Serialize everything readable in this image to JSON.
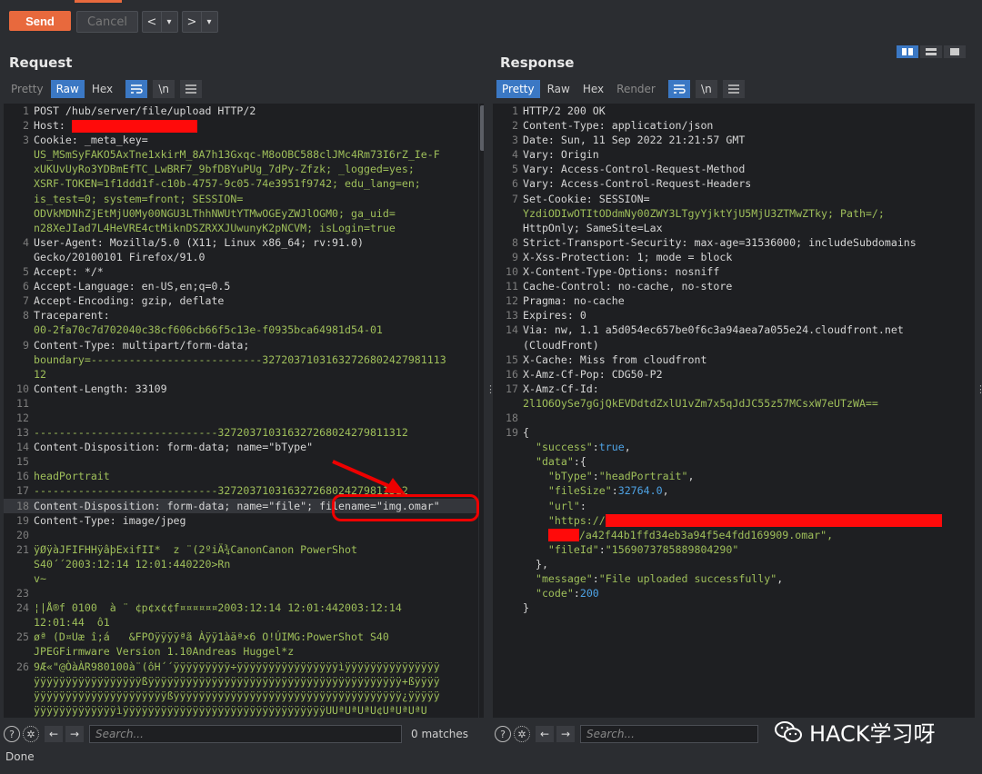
{
  "toolbar": {
    "send": "Send",
    "cancel": "Cancel",
    "back": "<",
    "fwd": ">",
    "dd": "▾"
  },
  "request": {
    "title": "Request",
    "tabs": [
      "Pretty",
      "Raw",
      "Hex"
    ],
    "active_tab": "Raw",
    "newline": "\\n",
    "lines": [
      {
        "n": "1",
        "t": "POST /hub/server/file/upload HTTP/2"
      },
      {
        "n": "2",
        "t": "Host: "
      },
      {
        "n": "3",
        "t": "Cookie: _meta_key="
      },
      {
        "n": "",
        "t": "US_MSmSyFAKO5AxTne1xkirM_8A7h13Gxqc-M8oOBC588clJMc4Rm73I6rZ_Ie-F"
      },
      {
        "n": "",
        "t": "xUKUvUyRo3YDBmEfTC_LwBRF7_9bfDBYuPUg_7dPy-Zfzk; _logged=yes;"
      },
      {
        "n": "",
        "t": "XSRF-TOKEN=1f1ddd1f-c10b-4757-9c05-74e3951f9742; edu_lang=en;"
      },
      {
        "n": "",
        "t": "is_test=0; system=front; SESSION="
      },
      {
        "n": "",
        "t": "ODVkMDNhZjEtMjU0My00NGU3LThhNWUtYTMwOGEyZWJlOGM0; ga_uid="
      },
      {
        "n": "",
        "t": "n28XeJIad7L4HeVRE4ctMiknDSZRXXJUwunyK2pNCVM; isLogin=true"
      },
      {
        "n": "4",
        "t": "User-Agent: Mozilla/5.0 (X11; Linux x86_64; rv:91.0)"
      },
      {
        "n": "",
        "t": "Gecko/20100101 Firefox/91.0"
      },
      {
        "n": "5",
        "t": "Accept: */*"
      },
      {
        "n": "6",
        "t": "Accept-Language: en-US,en;q=0.5"
      },
      {
        "n": "7",
        "t": "Accept-Encoding: gzip, deflate"
      },
      {
        "n": "8",
        "t": "Traceparent:"
      },
      {
        "n": "",
        "t": "00-2fa70c7d702040c38cf606cb66f5c13e-f0935bca64981d54-01"
      },
      {
        "n": "9",
        "t": "Content-Type: multipart/form-data;"
      },
      {
        "n": "",
        "t": "boundary=---------------------------32720371031632726802427981113"
      },
      {
        "n": "",
        "t": "12"
      },
      {
        "n": "10",
        "t": "Content-Length: 33109"
      },
      {
        "n": "11",
        "t": ""
      },
      {
        "n": "12",
        "t": ""
      },
      {
        "n": "13",
        "t": "-----------------------------327203710316327268024279811312"
      },
      {
        "n": "14",
        "t": "Content-Disposition: form-data; name=\"bType\""
      },
      {
        "n": "15",
        "t": ""
      },
      {
        "n": "16",
        "t": "headPortrait"
      },
      {
        "n": "17",
        "t": "-----------------------------327203710316327268024279811312"
      },
      {
        "n": "18",
        "t": "Content-Disposition: form-data; name=\"file\"; filename=\"img.omar\""
      },
      {
        "n": "19",
        "t": "Content-Type: image/jpeg"
      },
      {
        "n": "20",
        "t": ""
      },
      {
        "n": "21",
        "t": "ÿØÿàJFIFHHÿâþExifII*  z ¨(2ºiÄ¾CanonCanon PowerShot"
      },
      {
        "n": "",
        "t": "S40´´2003:12:14 12:01:440220>Rn"
      },
      {
        "n": "",
        "t": "v~"
      },
      {
        "n": "23",
        "t": ""
      },
      {
        "n": "24",
        "t": "¦|Å®f 0100  à ¨ ¢p¢x¢¢f¤¤¤¤¤¤2003:12:14 12:01:442003:12:14"
      },
      {
        "n": "",
        "t": "12:01:44  ô1"
      },
      {
        "n": "25",
        "t": "øª (D¤Uæ î;á   &FPOÿÿÿÿªã Àÿÿ1àäª×6 O!ÚIMG:PowerShot S40"
      },
      {
        "n": "",
        "t": "JPEGFirmware Version 1.10Andreas Huggel*z"
      },
      {
        "n": "26",
        "t": "9Æ«\"@ÒàÀR980100à¨(ôH´´ÿÿÿÿÿÿÿÿÿ÷ÿÿÿÿÿÿÿÿÿÿÿÿÿÿÿÿìÿÿÿÿÿÿÿÿÿÿÿÿÿÿÿ"
      },
      {
        "n": "",
        "t": "ÿÿÿÿÿÿÿÿÿÿÿÿÿÿÿÿÿßÿÿÿÿÿÿÿÿÿÿÿÿÿÿÿÿÿÿÿÿÿÿÿÿÿÿÿÿÿÿÿÿÿÿÿÿÿÿÿÿ+ßÿÿÿÿ"
      },
      {
        "n": "",
        "t": "ÿÿÿÿÿÿÿÿÿÿÿÿÿÿÿÿÿÿÿÿÿßÿÿÿÿÿÿÿÿÿÿÿÿÿÿÿÿÿÿÿÿÿÿÿÿÿÿÿÿÿÿÿÿÿÿÿÿ¿ÿÿÿÿÿ"
      },
      {
        "n": "",
        "t": "ÿÿÿÿÿÿÿÿÿÿÿÿÿìÿÿÿÿÿÿÿÿÿÿÿÿÿÿÿÿÿÿÿÿÿÿÿÿÿÿÿÿÿÿÿÿUUªUªUªU¢UªUªUªU"
      }
    ],
    "search_placeholder": "Search...",
    "matches": "0 matches"
  },
  "response": {
    "title": "Response",
    "tabs": [
      "Pretty",
      "Raw",
      "Hex",
      "Render"
    ],
    "active_tab": "Pretty",
    "newline": "\\n",
    "lines": [
      {
        "n": "1",
        "t": "HTTP/2 200 OK"
      },
      {
        "n": "2",
        "t": "Content-Type: application/json"
      },
      {
        "n": "3",
        "t": "Date: Sun, 11 Sep 2022 21:21:57 GMT"
      },
      {
        "n": "4",
        "t": "Vary: Origin"
      },
      {
        "n": "5",
        "t": "Vary: Access-Control-Request-Method"
      },
      {
        "n": "6",
        "t": "Vary: Access-Control-Request-Headers"
      },
      {
        "n": "7",
        "t": "Set-Cookie: SESSION="
      },
      {
        "n": "",
        "t": "YzdiODIwOTItODdmNy00ZWY3LTgyYjktYjU5MjU3ZTMwZTky; Path=/;"
      },
      {
        "n": "",
        "t": "HttpOnly; SameSite=Lax"
      },
      {
        "n": "8",
        "t": "Strict-Transport-Security: max-age=31536000; includeSubdomains"
      },
      {
        "n": "9",
        "t": "X-Xss-Protection: 1; mode = block"
      },
      {
        "n": "10",
        "t": "X-Content-Type-Options: nosniff"
      },
      {
        "n": "11",
        "t": "Cache-Control: no-cache, no-store"
      },
      {
        "n": "12",
        "t": "Pragma: no-cache"
      },
      {
        "n": "13",
        "t": "Expires: 0"
      },
      {
        "n": "14",
        "t": "Via: nw, 1.1 a5d054ec657be0f6c3a94aea7a055e24.cloudfront.net"
      },
      {
        "n": "",
        "t": "(CloudFront)"
      },
      {
        "n": "15",
        "t": "X-Cache: Miss from cloudfront"
      },
      {
        "n": "16",
        "t": "X-Amz-Cf-Pop: CDG50-P2"
      },
      {
        "n": "17",
        "t": "X-Amz-Cf-Id:"
      },
      {
        "n": "",
        "t": "2l1O6OySe7gGjQkEVDdtdZxlU1vZm7x5qJdJC55z57MCsxW7eUTzWA=="
      },
      {
        "n": "18",
        "t": ""
      },
      {
        "n": "19",
        "t": "{"
      }
    ],
    "json": {
      "success_key": "\"success\"",
      "success_val": "true",
      "data_key": "\"data\"",
      "btype_key": "\"bType\"",
      "btype_val": "\"headPortrait\"",
      "filesize_key": "\"fileSize\"",
      "filesize_val": "32764.0",
      "url_key": "\"url\"",
      "url_prefix": "\"https://",
      "url_suffix": "/a42f44b1ffd34eb3a94f5e4fdd169909.omar\",",
      "fileid_key": "\"fileId\"",
      "fileid_val": "\"1569073785889804290\"",
      "message_key": "\"message\"",
      "message_val": "\"File uploaded successfully\"",
      "code_key": "\"code\"",
      "code_val": "200"
    },
    "search_placeholder": "Search...",
    "matches": "hes"
  },
  "status": "Done",
  "watermark": "HACK学习呀",
  "colors": {
    "accent": "#e8693d",
    "tab_active": "#3b78c4",
    "annotation": "#ee0000"
  }
}
